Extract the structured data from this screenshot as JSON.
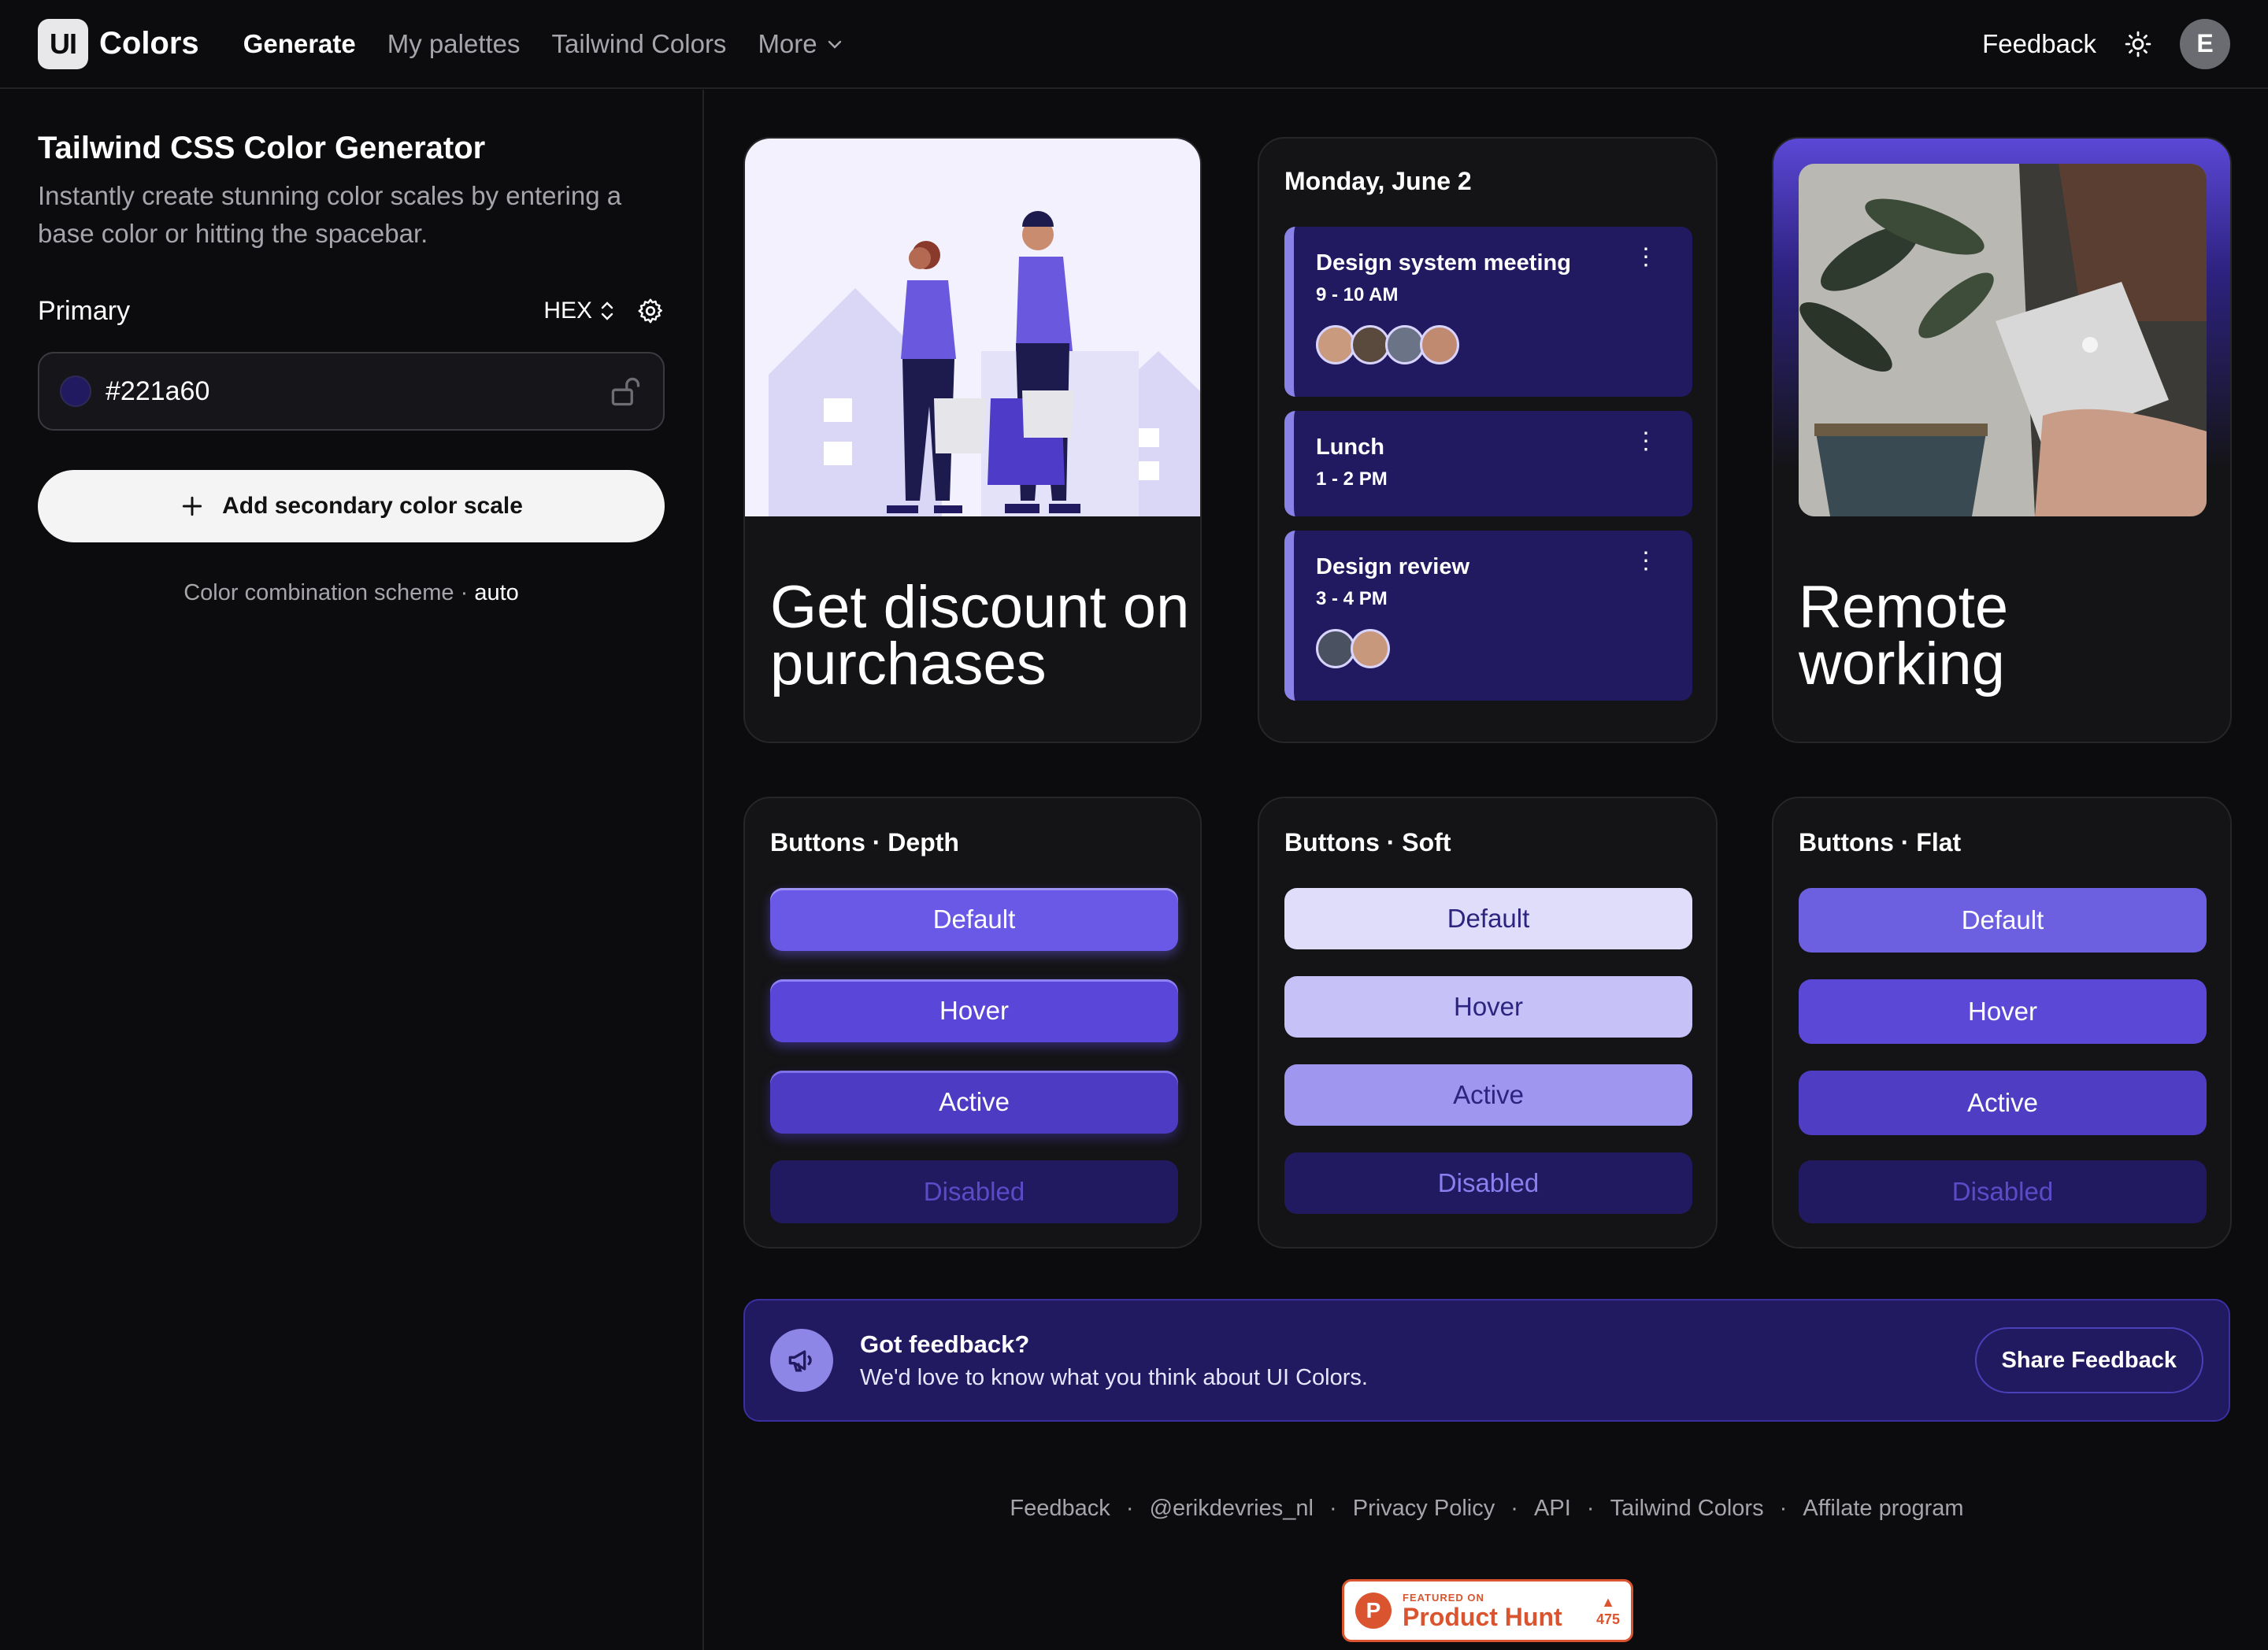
{
  "header": {
    "logo_mark": "UI",
    "logo_text": "Colors",
    "nav": [
      "Generate",
      "My palettes",
      "Tailwind Colors",
      "More"
    ],
    "feedback": "Feedback",
    "avatar_initial": "E"
  },
  "sidebar": {
    "title": "Tailwind CSS Color Generator",
    "subtitle": "Instantly create stunning color scales by entering a base color or hitting the spacebar.",
    "primary_label": "Primary",
    "format": "HEX",
    "color_value": "#221a60",
    "add_button": "Add secondary color scale",
    "scheme_label": "Color combination scheme ·",
    "scheme_value": "auto"
  },
  "cards": {
    "discount": "Get discount on purchases",
    "calendar": {
      "date": "Monday, June 2",
      "events": [
        {
          "title": "Design system meeting",
          "time": "9 - 10 AM"
        },
        {
          "title": "Lunch",
          "time": "1 - 2 PM"
        },
        {
          "title": "Design review",
          "time": "3 - 4 PM"
        }
      ]
    },
    "remote": "Remote working"
  },
  "buttons": {
    "depth": {
      "title": "Buttons · Depth",
      "labels": [
        "Default",
        "Hover",
        "Active",
        "Disabled"
      ]
    },
    "soft": {
      "title": "Buttons · Soft",
      "labels": [
        "Default",
        "Hover",
        "Active",
        "Disabled"
      ]
    },
    "flat": {
      "title": "Buttons · Flat",
      "labels": [
        "Default",
        "Hover",
        "Active",
        "Disabled"
      ]
    }
  },
  "banner": {
    "title": "Got feedback?",
    "subtitle": "We'd love to know what you think about UI Colors.",
    "button": "Share Feedback"
  },
  "footer": {
    "links": [
      "Feedback",
      "@erikdevries_nl",
      "Privacy Policy",
      "API",
      "Tailwind Colors",
      "Affilate program"
    ],
    "separator": "·"
  },
  "product_hunt": {
    "letter": "P",
    "featured": "FEATURED ON",
    "name": "Product Hunt",
    "votes": "475"
  },
  "colors": {
    "primary": "#221a60",
    "accent": "#5b48d6",
    "soft_default": "#e0ddfb",
    "soft_hover": "#c6c1f6",
    "soft_active": "#9f97ef",
    "flat_default": "#6c5fe0",
    "flat_hover": "#5b48d6",
    "flat_active": "#4f3dc4"
  }
}
